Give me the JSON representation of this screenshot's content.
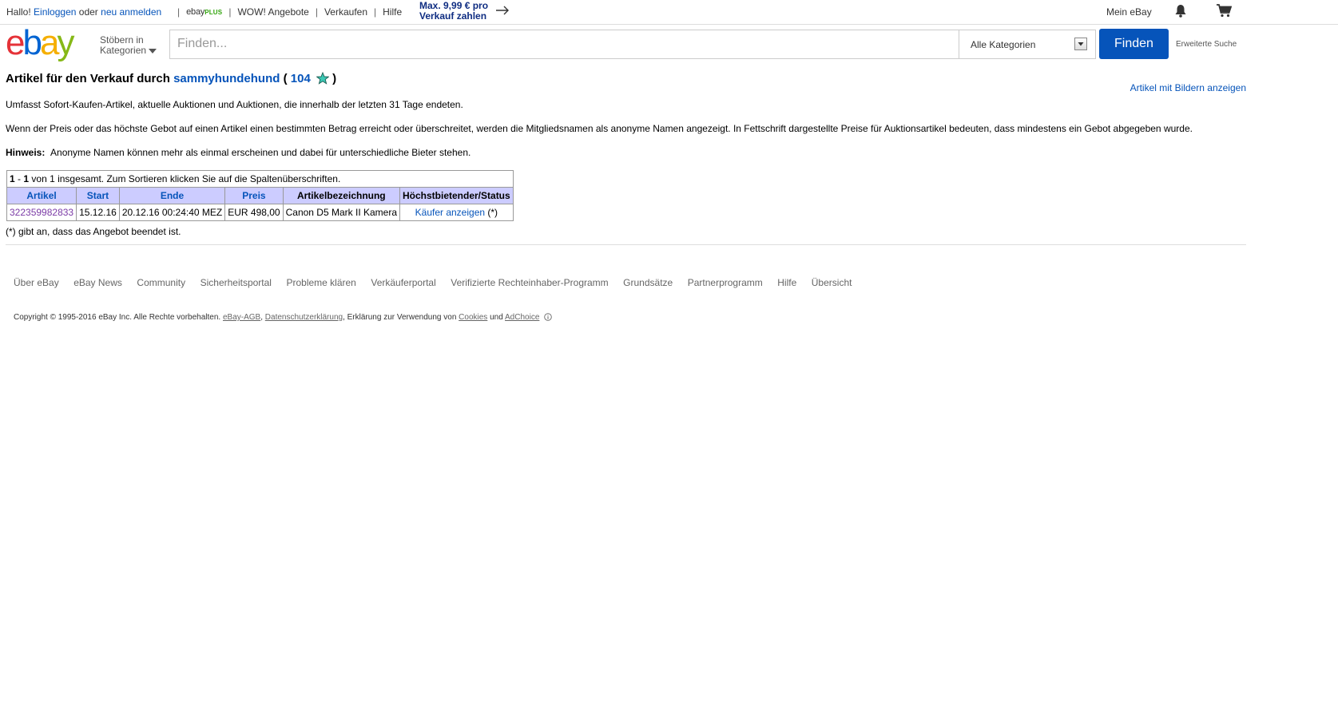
{
  "topbar": {
    "greeting_prefix": "Hallo!",
    "login_link": "Einloggen",
    "or_text": "oder",
    "register_link": "neu anmelden",
    "ebayplus_prefix": "ebay",
    "ebayplus_suffix": "PLUS",
    "menu": [
      "WOW! Angebote",
      "Verkaufen",
      "Hilfe"
    ],
    "promo_line1": "Max. 9,99 € pro",
    "promo_line2": "Verkauf zahlen",
    "mein_ebay": "Mein eBay",
    "icons": [
      "bell-icon",
      "cart-icon",
      "arrow-right-icon"
    ]
  },
  "header": {
    "stoebern_line1": "Stöbern in",
    "stoebern_line2": "Kategorien",
    "search_placeholder": "Finden...",
    "category_selected": "Alle Kategorien",
    "search_button": "Finden",
    "advanced_search": "Erweiterte Suche"
  },
  "content": {
    "title_prefix": "Artikel für den Verkauf durch",
    "seller_name": "sammyhundehund",
    "open_paren": "(",
    "feedback_score": "104",
    "close_paren": ")",
    "show_with_pictures": "Artikel mit Bildern anzeigen",
    "para1": "Umfasst Sofort-Kaufen-Artikel, aktuelle Auktionen und Auktionen, die innerhalb der letzten 31 Tage endeten.",
    "para2": "Wenn der Preis oder das höchste Gebot auf einen Artikel einen bestimmten Betrag erreicht oder überschreitet, werden die Mitgliedsnamen als anonyme Namen angezeigt. In Fettschrift dargestellte Preise für Auktionsartikel bedeuten, dass mindestens ein Gebot abgegeben wurde.",
    "note_label": "Hinweis:",
    "note_text": "Anonyme Namen können mehr als einmal erscheinen und dabei für unterschiedliche Bieter stehen.",
    "footnote": "(*) gibt an, dass das Angebot beendet ist."
  },
  "table": {
    "range_from": "1",
    "range_dash": "-",
    "range_to": "1",
    "range_text": "von 1 insgesamt. Zum Sortieren klicken Sie auf die Spaltenüberschriften.",
    "headers": [
      "Artikel",
      "Start",
      "Ende",
      "Preis",
      "Artikelbezeichnung",
      "Höchstbietender/Status"
    ],
    "rows": [
      {
        "item_id": "322359982833",
        "start": "15.12.16",
        "end": "20.12.16 00:24:40 MEZ",
        "price": "EUR 498,00",
        "title": "Canon D5 Mark II Kamera",
        "status_link": "Käufer anzeigen",
        "status_mark": "(*)"
      }
    ]
  },
  "footer": {
    "links": [
      "Über eBay",
      "eBay News",
      "Community",
      "Sicherheitsportal",
      "Probleme klären",
      "Verkäuferportal",
      "Verifizierte Rechteinhaber-Programm",
      "Grundsätze",
      "Partnerprogramm",
      "Hilfe",
      "Übersicht"
    ],
    "copyright_prefix": "Copyright © 1995-2016 eBay Inc. Alle Rechte vorbehalten.",
    "agb": "eBay-AGB",
    "comma1": ",",
    "datenschutz": "Datenschutzerklärung",
    "cookies_prefix": ", Erklärung zur Verwendung von",
    "cookies": "Cookies",
    "und": "und",
    "adchoice": "AdChoice"
  },
  "colors": {
    "link_blue": "#0654ba",
    "visited_purple": "#7b3ba6",
    "header_bg": "#ccccff",
    "logo_red": "#e53238",
    "logo_blue": "#0064d2",
    "logo_yellow": "#f5af02",
    "logo_green": "#86b817"
  }
}
